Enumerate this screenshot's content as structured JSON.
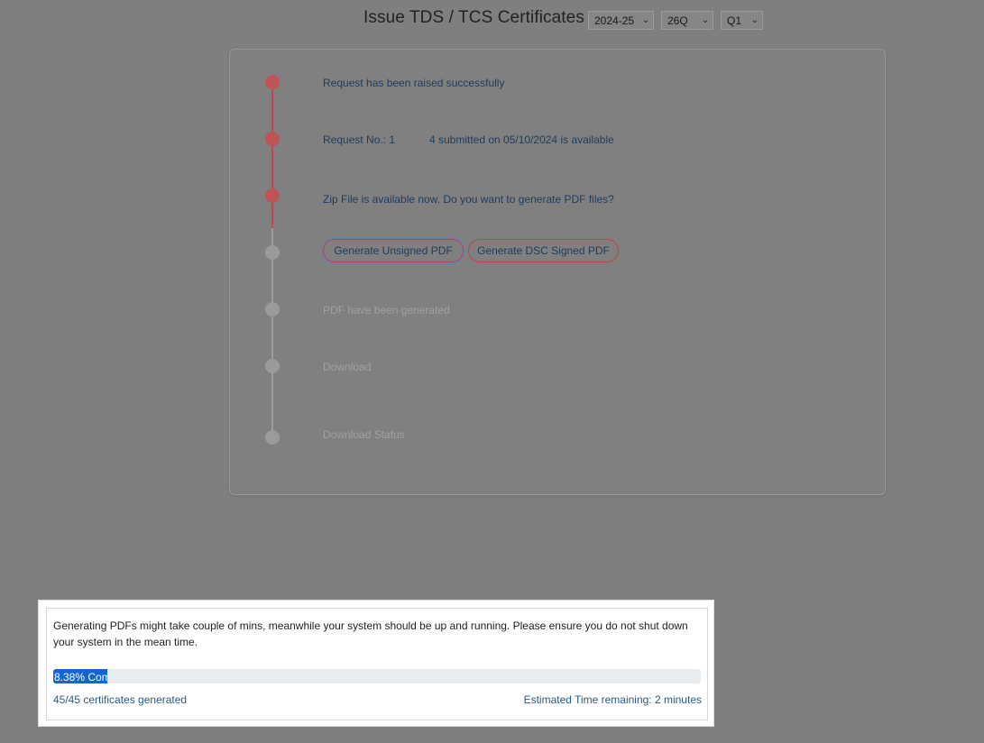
{
  "header": {
    "title": "Issue TDS / TCS Certificates",
    "financial_year": "2024-25",
    "form_type": "26Q",
    "quarter": "Q1"
  },
  "steps": [
    {
      "label": "Request has been raised successfully",
      "status": "done"
    },
    {
      "label": "Request No.: 1",
      "detail": "4 submitted on 05/10/2024 is available",
      "status": "done"
    },
    {
      "label": "Zip File is available now. Do you want to generate PDF files?",
      "status": "done"
    },
    {
      "label": "",
      "status": "pending"
    },
    {
      "label": "PDF have been generated",
      "status": "pending"
    },
    {
      "label": "Download",
      "status": "pending"
    },
    {
      "label": "Download Status",
      "status": "pending"
    }
  ],
  "buttons": {
    "unsigned": "Generate Unsigned PDF",
    "dsc": "Generate DSC Signed PDF"
  },
  "popup": {
    "message": "Generating PDFs might take couple of mins, meanwhile your system should be up and running. Please ensure you do not shut down your system in the mean time.",
    "progress_label": "8.38% Com",
    "progress_percent": 8.38,
    "count_text": "45/45 certificates generated",
    "eta_text": "Estimated Time remaining: 2 minutes"
  },
  "colors": {
    "done": "#bf5355",
    "pending": "#9b9b9b",
    "progress": "#1166d6"
  }
}
